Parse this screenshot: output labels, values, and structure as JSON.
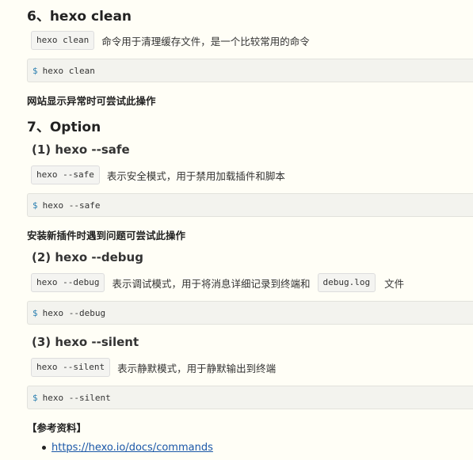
{
  "sections": {
    "clean": {
      "heading": "6、hexo clean",
      "inline_code": "hexo clean",
      "desc": "命令用于清理缓存文件，是一个比较常用的命令",
      "prompt": "$",
      "command": "hexo clean",
      "note": "网站显示异常时可尝试此操作"
    },
    "option": {
      "heading": "7、Option",
      "safe": {
        "heading": "(1) hexo --safe",
        "inline_code": "hexo --safe",
        "desc": "表示安全模式，用于禁用加载插件和脚本",
        "prompt": "$",
        "command": "hexo --safe",
        "note": "安装新插件时遇到问题可尝试此操作"
      },
      "debug": {
        "heading": "(2) hexo --debug",
        "inline_code": "hexo --debug",
        "desc": "表示调试模式，用于将消息详细记录到终端和",
        "inline_code_2": "debug.log",
        "desc_tail": "文件",
        "prompt": "$",
        "command": "hexo --debug"
      },
      "silent": {
        "heading": "(3) hexo --silent",
        "inline_code": "hexo --silent",
        "desc": "表示静默模式，用于静默输出到终端",
        "prompt": "$",
        "command": "hexo --silent"
      }
    }
  },
  "references": {
    "title": "【参考资料】",
    "links": [
      "https://hexo.io/docs/commands"
    ]
  }
}
